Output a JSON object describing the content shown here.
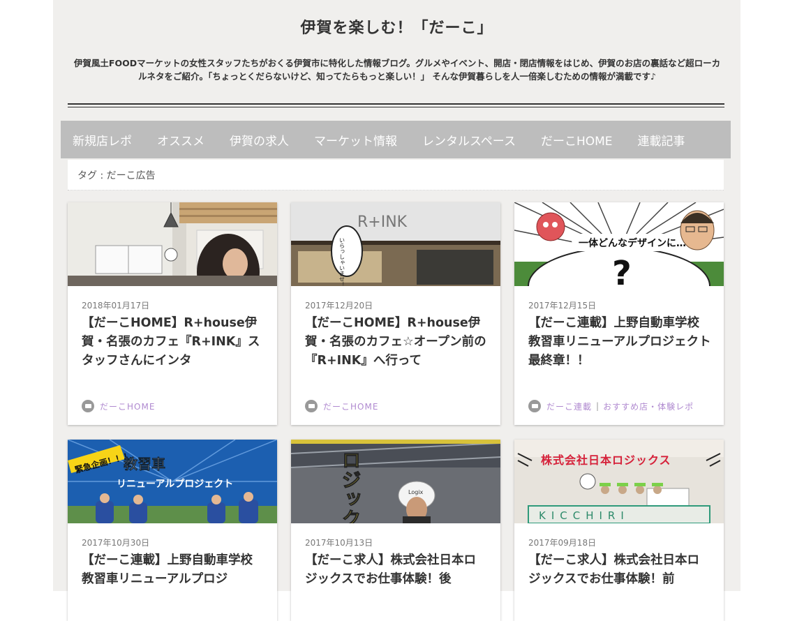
{
  "header": {
    "title": "伊賀を楽しむ！「だーこ」",
    "description": "伊賀風土FOODマーケットの女性スタッフたちがおくる伊賀市に特化した情報ブログ。グルメやイベント、開店・閉店情報をはじめ、伊賀のお店の裏話など超ローカルネタをご紹介。「ちょっとくだらないけど、知ってたらもっと楽しい！」 そんな伊賀暮らしを人一倍楽しむための情報が満載です♪"
  },
  "nav": {
    "items": [
      {
        "label": "新規店レポ"
      },
      {
        "label": "オススメ"
      },
      {
        "label": "伊賀の求人"
      },
      {
        "label": "マーケット情報"
      },
      {
        "label": "レンタルスペース"
      },
      {
        "label": "だーこHOME"
      },
      {
        "label": "連載記事"
      }
    ]
  },
  "tag": {
    "label": "タグ : だーこ広告"
  },
  "posts": [
    {
      "date": "2018年01月17日",
      "title": "【だーこHOME】R+house伊賀・名張のカフェ『R+INK』スタッフさんにインタ",
      "categories": [
        "だーこHOME"
      ]
    },
    {
      "date": "2017年12月20日",
      "title": "【だーこHOME】R+house伊賀・名張のカフェ☆オープン前の『R+INK』へ行って",
      "categories": [
        "だーこHOME"
      ]
    },
    {
      "date": "2017年12月15日",
      "title": "【だーこ連載】上野自動車学校 教習車リニューアルプロジェクト最終章！！",
      "categories": [
        "だーこ連載",
        "おすすめ店・体験レポ"
      ]
    },
    {
      "date": "2017年10月30日",
      "title": "【だーこ連載】上野自動車学校 教習車リニューアルプロジ",
      "categories": []
    },
    {
      "date": "2017年10月13日",
      "title": "【だーこ求人】株式会社日本ロジックスでお仕事体験！後",
      "categories": []
    },
    {
      "date": "2017年09月18日",
      "title": "【だーこ求人】株式会社日本ロジックスでお仕事体験！前",
      "categories": []
    }
  ],
  "thumbs": {
    "t2_sign": "R+INK",
    "t2_bubble": "いらっしゃいませ！",
    "t3_bubble": "一体どんなデザインに…",
    "t3_mark": "?",
    "t4_banner": "緊急企画！！！",
    "t4_title1": "教習車",
    "t4_title2": "リニューアルプロジェクト",
    "t5_text": "ロジックス",
    "t5_helmet": "Logix",
    "t6_banner": "株式会社日本ロジックス",
    "t6_sign": "KICCHIRI"
  },
  "colors": {
    "nav_bg": "#bdbdbd",
    "page_bg": "#f0efed",
    "category": "#b08ad0"
  }
}
